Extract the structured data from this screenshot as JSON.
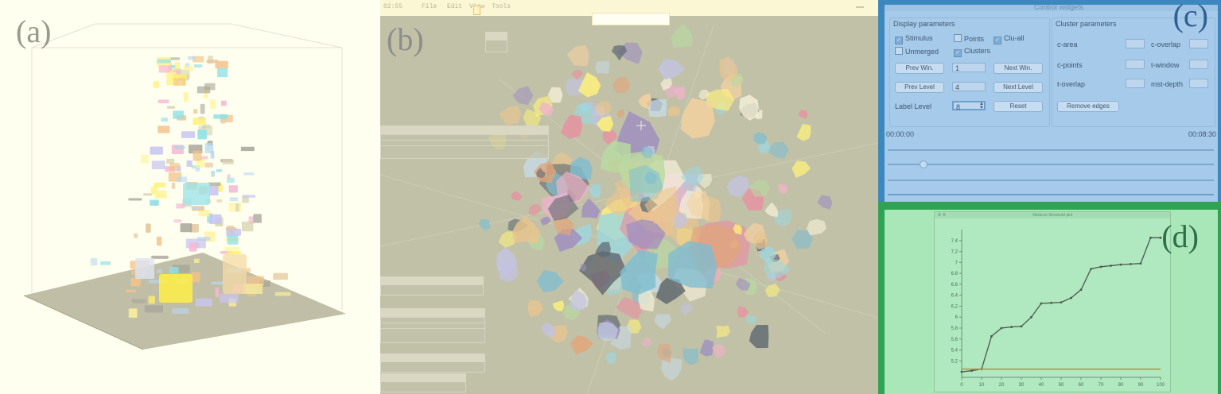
{
  "panels": {
    "a": {
      "label": "(a)"
    },
    "b": {
      "label": "(b)",
      "clock": "02:55",
      "menu": [
        "File",
        "Edit",
        "View",
        "Tools"
      ]
    },
    "c": {
      "label": "(c)"
    },
    "d": {
      "label": "(d)"
    }
  },
  "control_widgets": {
    "window_title": "Control widgets",
    "display_parameters": {
      "title": "Display parameters",
      "checkboxes": [
        {
          "label": "Stimulus",
          "checked": true
        },
        {
          "label": "Points",
          "checked": false
        },
        {
          "label": "Clu-all",
          "checked": true
        },
        {
          "label": "Unmerged",
          "checked": false
        },
        {
          "label": "Clusters",
          "checked": true
        }
      ],
      "prev_win": "Prev Win.",
      "win_value": "1",
      "next_win": "Next Win.",
      "prev_level": "Prev Level",
      "level_value": "4",
      "next_level": "Next Level",
      "label_level": "Label Level",
      "label_level_value": "8",
      "reset": "Reset"
    },
    "cluster_parameters": {
      "title": "Cluster parameters",
      "fields": [
        "c-area",
        "c-overlap",
        "c-points",
        "t-window",
        "t-overlap",
        "mst-depth"
      ],
      "remove_edges": "Remove edges"
    },
    "time_start": "00:00:00",
    "time_end": "00:08:30"
  },
  "variance_plot": {
    "window_title": "Variance threshold plot",
    "chart_data": {
      "type": "line",
      "title": "",
      "xlabel": "",
      "ylabel": "",
      "xlim": [
        0,
        100
      ],
      "ylim": [
        4.9,
        7.6
      ],
      "x_ticks": [
        0,
        10,
        20,
        30,
        40,
        50,
        60,
        70,
        80,
        90,
        100
      ],
      "y_ticks": [
        5.2,
        5.4,
        5.6,
        5.8,
        6,
        6.2,
        6.4,
        6.6,
        6.8,
        7,
        7.2,
        7.4
      ],
      "y_tick_labels": [
        "5.2",
        "5.4",
        "5.6",
        "5.8",
        "6",
        "6.2",
        "6.4",
        "6.6",
        "6.8",
        "7",
        "7.2",
        "7.4"
      ],
      "series": [
        {
          "x": [
            0,
            5,
            10,
            15,
            20,
            25,
            30,
            35,
            40,
            45,
            50,
            55,
            60,
            65,
            70,
            75,
            80,
            85,
            90,
            95,
            100
          ],
          "y": [
            5.0,
            5.02,
            5.05,
            5.65,
            5.8,
            5.82,
            5.83,
            6.0,
            6.25,
            6.26,
            6.27,
            6.35,
            6.5,
            6.88,
            6.92,
            6.94,
            6.96,
            6.97,
            6.98,
            7.45,
            7.45
          ],
          "color": "#4a5a4e"
        },
        {
          "x": [
            0,
            100
          ],
          "y": [
            5.05,
            5.05
          ],
          "color": "#a69a57"
        }
      ]
    }
  }
}
